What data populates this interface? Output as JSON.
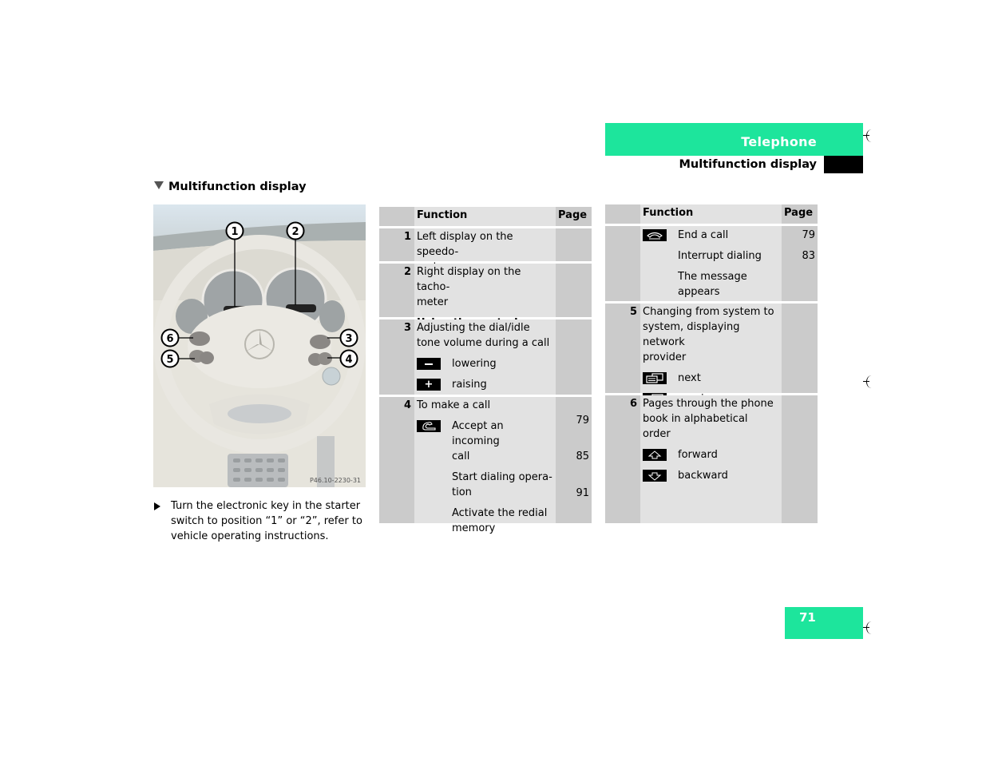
{
  "header": {
    "chapter": "Telephone",
    "section": "Multifunction display"
  },
  "left": {
    "heading": "Multifunction display",
    "figure": {
      "callouts": [
        "1",
        "2",
        "3",
        "4",
        "5",
        "6"
      ],
      "code": "P46.10-2230-31"
    },
    "instruction": "Turn the electronic key in the starter switch to position “1” or “2”, refer to vehicle operating instructions."
  },
  "table1": {
    "col_function": "Function",
    "col_page": "Page",
    "row1": {
      "num": "1",
      "lines": [
        "Left display on the speedo-",
        "meter"
      ]
    },
    "row2": {
      "num": "2",
      "lines": [
        "Right display on the tacho-",
        "meter"
      ],
      "subheading": "Using the control system"
    },
    "row3": {
      "num": "3",
      "lines": [
        "Adjusting the dial/idle",
        "tone volume during a call"
      ],
      "items": [
        {
          "icon": "minus-icon",
          "label": "lowering"
        },
        {
          "icon": "plus-icon",
          "label": "raising"
        }
      ]
    },
    "row4": {
      "num": "4",
      "lines": [
        "To make a call"
      ],
      "icon": "phone-pickup-icon",
      "items": [
        {
          "label_lines": [
            "Accept an incoming",
            "call"
          ],
          "page": "79"
        },
        {
          "label_lines": [
            "Start dialing opera-",
            "tion"
          ],
          "page": "85"
        },
        {
          "label_lines": [
            "Activate the redial",
            "memory"
          ],
          "page": "91"
        }
      ]
    }
  },
  "table2": {
    "col_function": "Function",
    "col_page": "Page",
    "rowA": {
      "icon": "phone-hangup-icon",
      "items": [
        {
          "label_lines": [
            "End a call"
          ],
          "page": "79"
        },
        {
          "label_lines": [
            "Interrupt dialing"
          ],
          "page": "83"
        },
        {
          "label_lines": [
            "The message",
            "appears"
          ],
          "page": ""
        }
      ]
    },
    "row5": {
      "num": "5",
      "lines": [
        "Changing from system to",
        "system, displaying network",
        "provider"
      ],
      "items": [
        {
          "icon": "next-system-icon",
          "label": "next"
        },
        {
          "icon": "previous-system-icon",
          "label": "previous"
        }
      ]
    },
    "row6": {
      "num": "6",
      "lines": [
        "Pages through the phone",
        "book in alphabetical order"
      ],
      "items": [
        {
          "icon": "arrow-up-icon",
          "label": "forward"
        },
        {
          "icon": "arrow-down-icon",
          "label": "backward"
        }
      ]
    }
  },
  "page_number": "71",
  "colors": {
    "accent": "#1de59c",
    "table_dark": "#cbcbcb",
    "table_light": "#e2e2e2"
  }
}
